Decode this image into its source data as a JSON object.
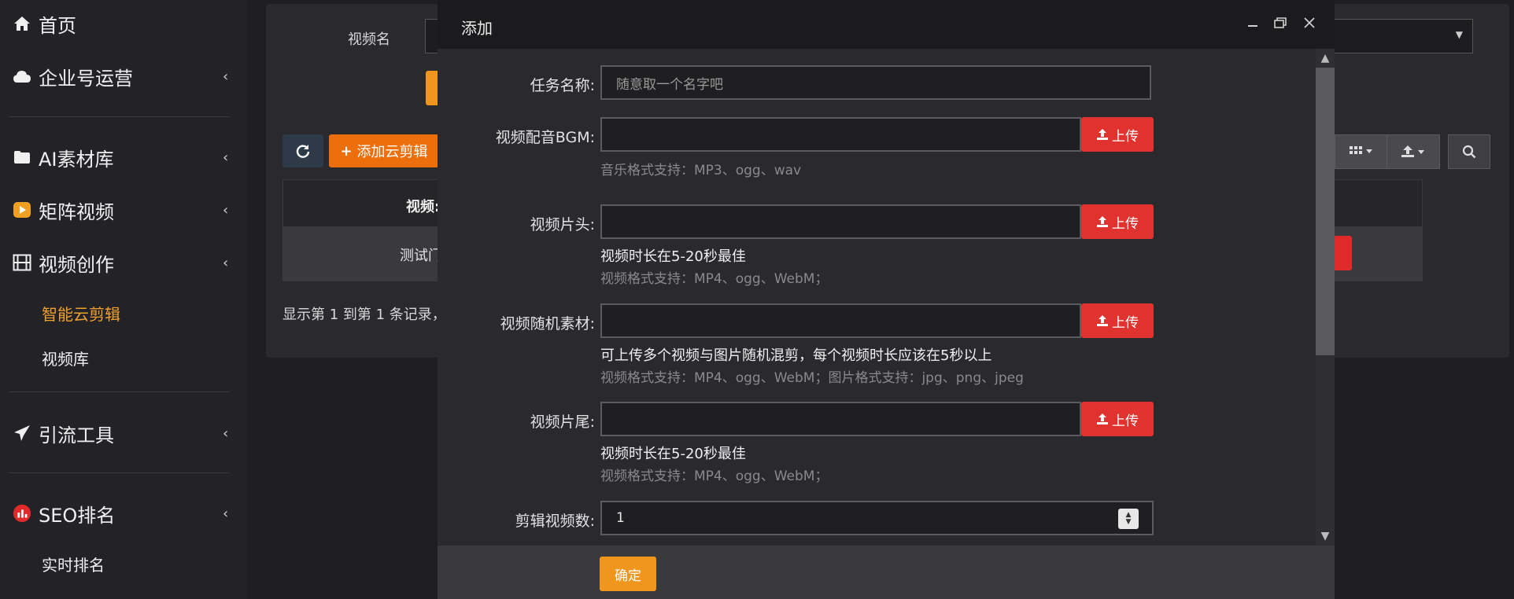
{
  "sidebar": {
    "home": "首页",
    "enterprise": "企业号运营",
    "ai_library": "AI素材库",
    "matrix_video": "矩阵视频",
    "video_creation": "视频创作",
    "smart_cloud_clip": "智能云剪辑",
    "video_library": "视频库",
    "traffic_tools": "引流工具",
    "seo_ranking": "SEO排名",
    "realtime_ranking": "实时排名",
    "chevron": "‹"
  },
  "background": {
    "video_name_label": "视频名",
    "add_clip_button": "添加云剪辑",
    "table_header_partial": "视频:",
    "table_cell_partial": "测试门",
    "pagination_text": "显示第 1 到第 1 条记录，"
  },
  "modal": {
    "title": "添加",
    "task_name_label": "任务名称:",
    "task_name_placeholder": "随意取一个名字吧",
    "bgm_label": "视频配音BGM:",
    "bgm_hint": "音乐格式支持：MP3、ogg、wav",
    "intro_label": "视频片头:",
    "intro_hint1": "视频时长在5-20秒最佳",
    "intro_hint2": "视频格式支持：MP4、ogg、WebM；",
    "random_label": "视频随机素材:",
    "random_hint1": "可上传多个视频与图片随机混剪，每个视频时长应该在5秒以上",
    "random_hint2": "视频格式支持：MP4、ogg、WebM；图片格式支持：jpg、png、jpeg",
    "outro_label": "视频片尾:",
    "outro_hint1": "视频时长在5-20秒最佳",
    "outro_hint2": "视频格式支持：MP4、ogg、WebM；",
    "count_label": "剪辑视频数:",
    "count_value": "1",
    "upload_label": "上传",
    "confirm_button": "确定"
  },
  "colors": {
    "accent_orange": "#f0961e",
    "upload_red": "#e0332f",
    "active_menu": "#f0a030"
  },
  "icons": [
    "home-icon",
    "cloud-icon",
    "folder-icon",
    "play-badge-icon",
    "film-icon",
    "paper-plane-icon",
    "chart-badge-icon",
    "refresh-icon",
    "plus-icon",
    "upload-icon",
    "grid-icon",
    "export-icon",
    "search-icon",
    "minimize-icon",
    "restore-icon",
    "close-icon"
  ]
}
